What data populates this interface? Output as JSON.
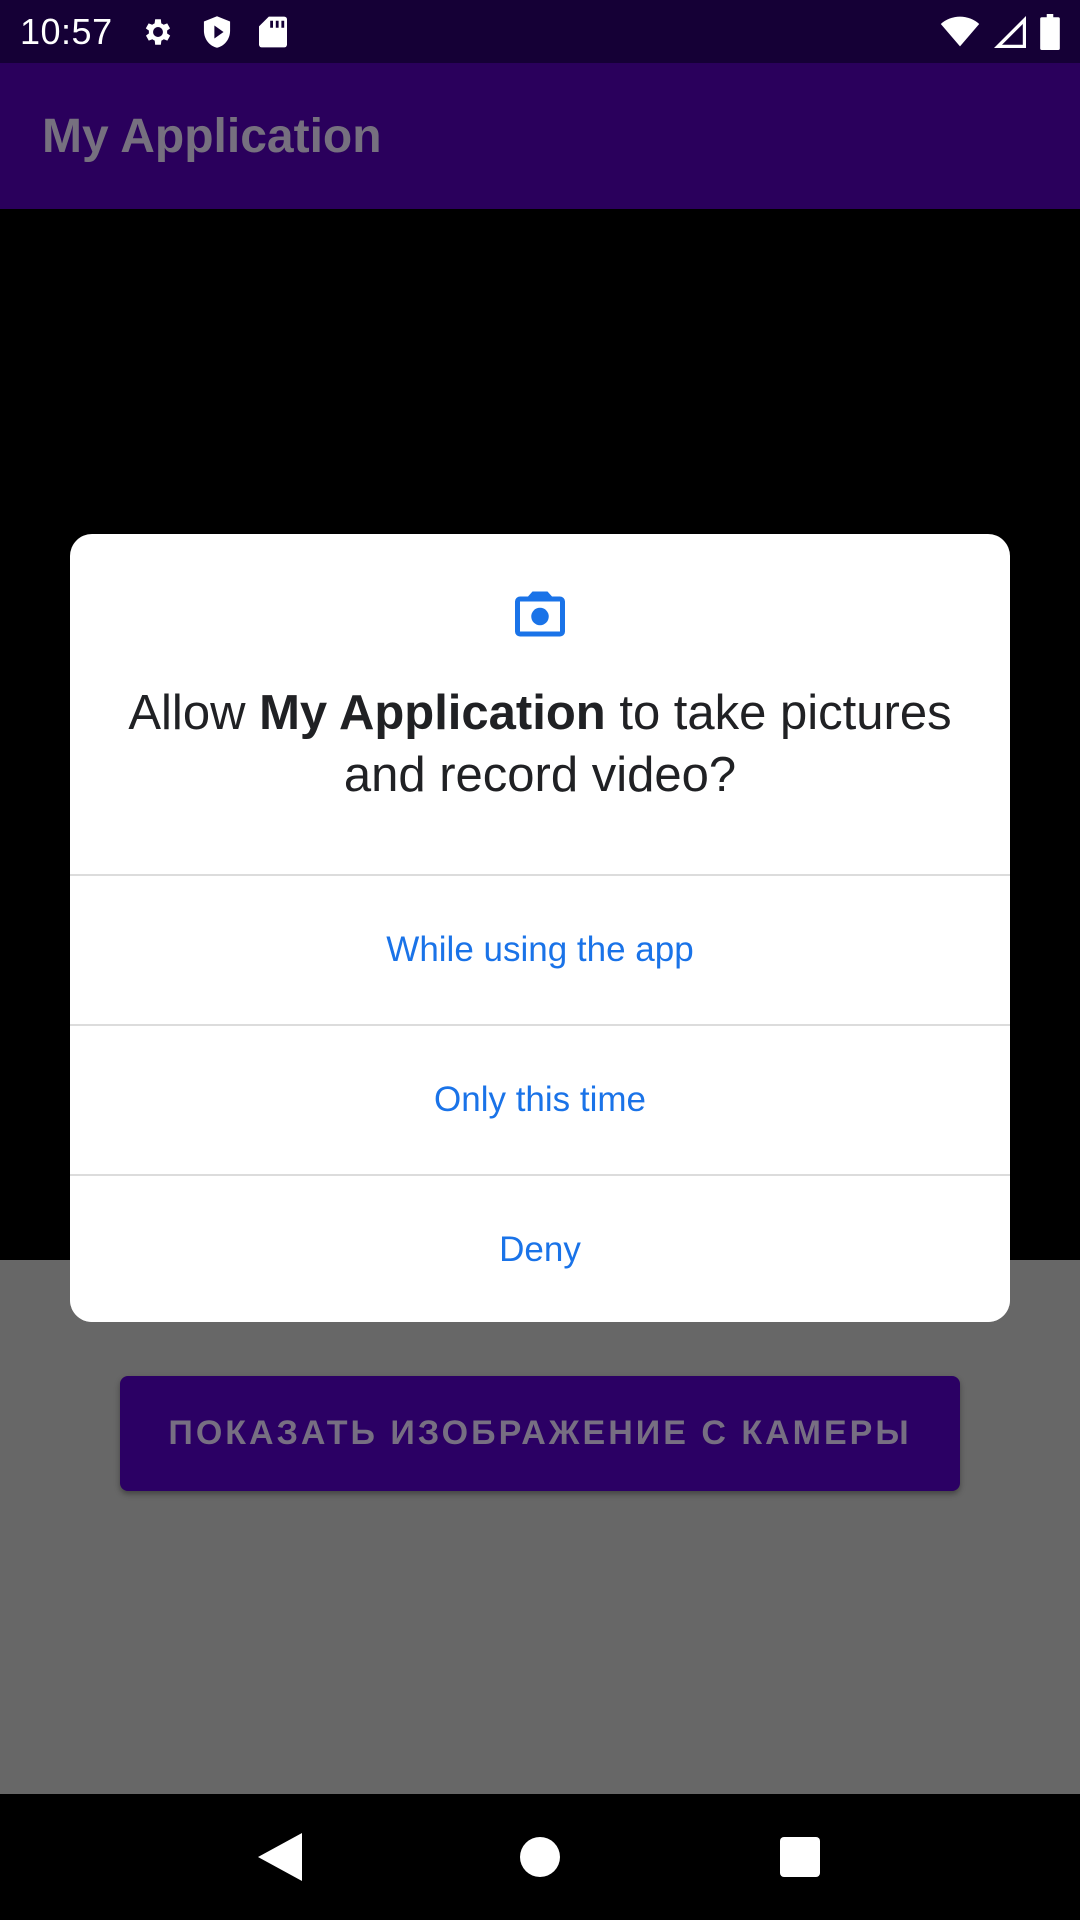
{
  "status_bar": {
    "time": "10:57",
    "left_icons": [
      "settings-icon",
      "shield-icon",
      "sd-card-icon"
    ],
    "right_icons": [
      "wifi-icon",
      "cellular-signal-icon",
      "battery-icon"
    ]
  },
  "app_bar": {
    "title": "My Application"
  },
  "main": {
    "camera_button_label": "ПОКАЗАТЬ ИЗОБРАЖЕНИЕ С КАМЕРЫ"
  },
  "dialog": {
    "icon": "camera-icon",
    "message_prefix": "Allow ",
    "message_app_name": "My Application",
    "message_suffix": " to take pictures and record video?",
    "options": [
      {
        "label": "While using the app"
      },
      {
        "label": "Only this time"
      },
      {
        "label": "Deny"
      }
    ],
    "accent_color": "#1a73e8"
  },
  "nav_bar": {
    "buttons": [
      "back-icon",
      "home-icon",
      "recents-icon"
    ]
  },
  "colors": {
    "status_bar": "#150036",
    "app_bar": "#2a005c",
    "scrim_gray": "#676767",
    "button": "#2b0064"
  }
}
